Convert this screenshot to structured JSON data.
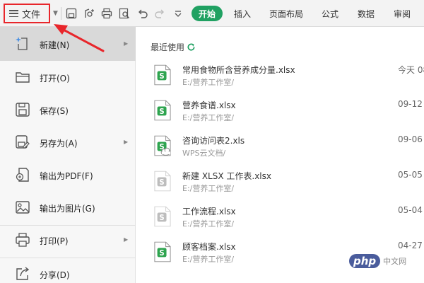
{
  "toolbar": {
    "file_label": "文件",
    "active_tab": "开始",
    "tabs": [
      "插入",
      "页面布局",
      "公式",
      "数据",
      "审阅"
    ]
  },
  "menu": {
    "items": [
      {
        "label": "新建(N)",
        "icon": "new-sparkle-icon",
        "has_submenu": true,
        "active": true
      },
      {
        "label": "打开(O)",
        "icon": "folder-open-icon",
        "has_submenu": false
      },
      {
        "label": "保存(S)",
        "icon": "save-icon",
        "has_submenu": false
      },
      {
        "label": "另存为(A)",
        "icon": "save-as-icon",
        "has_submenu": true
      },
      {
        "label": "输出为PDF(F)",
        "icon": "export-pdf-icon",
        "has_submenu": false
      },
      {
        "label": "输出为图片(G)",
        "icon": "export-image-icon",
        "has_submenu": false
      },
      {
        "label": "打印(P)",
        "icon": "printer-icon",
        "has_submenu": true
      },
      {
        "label": "分享(D)",
        "icon": "share-icon",
        "has_submenu": false
      }
    ]
  },
  "recent": {
    "title": "最近使用",
    "files": [
      {
        "name": "常用食物所含营养成分量.xlsx",
        "path": "E:/营养工作室/",
        "date": "今天 08",
        "style": "green",
        "cloud": false
      },
      {
        "name": "营养食谱.xlsx",
        "path": "E:/营养工作室/",
        "date": "09-12",
        "style": "green",
        "cloud": false
      },
      {
        "name": "咨询访问表2.xls",
        "path": "WPS云文档/",
        "date": "09-06",
        "style": "green",
        "cloud": true
      },
      {
        "name": "新建 XLSX 工作表.xlsx",
        "path": "E:/营养工作室/",
        "date": "05-05",
        "style": "gray",
        "cloud": false
      },
      {
        "name": "工作流程.xlsx",
        "path": "E:/营养工作室/",
        "date": "05-04",
        "style": "gray",
        "cloud": false
      },
      {
        "name": "顾客档案.xlsx",
        "path": "E:/营养工作室/",
        "date": "04-27",
        "style": "green",
        "cloud": false
      }
    ]
  },
  "watermark": {
    "logo": "php",
    "text": "中文网"
  },
  "colors": {
    "accent_green": "#20a162",
    "highlight_red": "#e8262b",
    "active_item": "#d9d9d9"
  }
}
